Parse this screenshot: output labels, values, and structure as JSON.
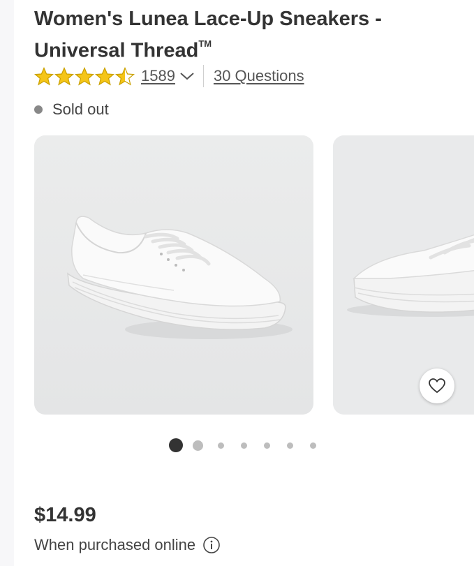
{
  "product": {
    "title": "Women's Lunea Lace-Up Sneakers - Universal Thread",
    "title_line1": "Women's Lunea Lace-Up Sneakers -",
    "title_line2": "Universal Thread",
    "trademark": "TM",
    "rating": {
      "value": 4.5,
      "max": 5,
      "star_color": "#f5c518"
    },
    "review_count": "1589",
    "questions_link": "30 Questions",
    "status": "Sold out",
    "status_dot_color": "#888888",
    "price": "$14.99",
    "purchase_note": "When purchased online",
    "info_icon": "info-icon"
  },
  "carousel": {
    "images": [
      "white-canvas-sneaker-side",
      "white-canvas-sneaker-front"
    ],
    "dots_total": 7,
    "active_dot": 1,
    "favorite_icon": "heart-icon"
  }
}
